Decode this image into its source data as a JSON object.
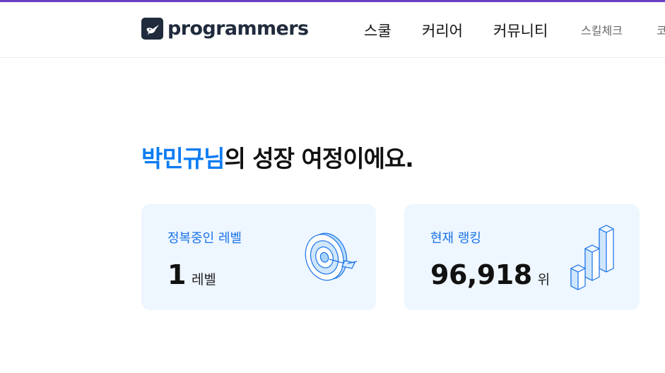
{
  "brand": {
    "name": "programmers",
    "logo_icon": "hummingbird-icon",
    "accent_color": "#6a3fc4",
    "dark_color": "#202b3d"
  },
  "nav": {
    "items": [
      {
        "label": "스쿨"
      },
      {
        "label": "커리어"
      },
      {
        "label": "커뮤니티"
      },
      {
        "label": "스킬체크"
      },
      {
        "label": "코"
      }
    ]
  },
  "main": {
    "headline": {
      "name": "박민규님",
      "rest": "의 성장 여정이에요."
    },
    "cards": [
      {
        "label": "정복중인 레벨",
        "value": "1",
        "unit": "레벨",
        "icon": "target-icon"
      },
      {
        "label": "현재 랭킹",
        "value": "96,918",
        "unit": "위",
        "icon": "bar-chart-icon"
      }
    ],
    "highlight_color": "#0d7cf2",
    "card_bg": "#eef6ff"
  }
}
